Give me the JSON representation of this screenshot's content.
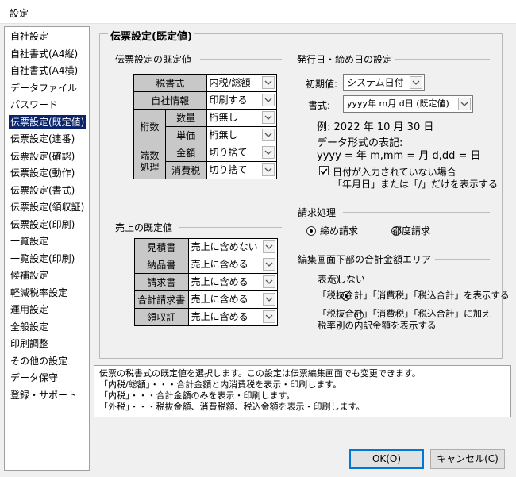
{
  "window": {
    "title": "設定"
  },
  "sidebar": {
    "items": [
      {
        "label": "自社設定"
      },
      {
        "label": "自社書式(A4縦)"
      },
      {
        "label": "自社書式(A4横)"
      },
      {
        "label": "データファイル"
      },
      {
        "label": "パスワード"
      },
      {
        "label": "伝票設定(既定値)",
        "selected": true
      },
      {
        "label": "伝票設定(連番)"
      },
      {
        "label": "伝票設定(確認)"
      },
      {
        "label": "伝票設定(動作)"
      },
      {
        "label": "伝票設定(書式)"
      },
      {
        "label": "伝票設定(領収証)"
      },
      {
        "label": "伝票設定(印刷)"
      },
      {
        "label": "一覧設定"
      },
      {
        "label": "一覧設定(印刷)"
      },
      {
        "label": "候補設定"
      },
      {
        "label": "軽減税率設定"
      },
      {
        "label": "運用設定"
      },
      {
        "label": "全般設定"
      },
      {
        "label": "印刷調整"
      },
      {
        "label": "その他の設定"
      },
      {
        "label": "データ保守"
      },
      {
        "label": "登録・サポート"
      }
    ]
  },
  "main": {
    "group_title": "伝票設定(既定値)",
    "voucher_defaults": {
      "heading": "伝票設定の既定値",
      "tax_format_label": "税書式",
      "tax_format_value": "内税/総額",
      "company_info_label": "自社情報",
      "company_info_value": "印刷する",
      "digits_label": "桁数",
      "quantity_label": "数量",
      "quantity_value": "桁無し",
      "unit_price_label": "単価",
      "unit_price_value": "桁無し",
      "rounding_label_1": "端数",
      "rounding_label_2": "処理",
      "amount_label": "金額",
      "amount_value": "切り捨て",
      "consumption_tax_label": "消費税",
      "consumption_tax_value": "切り捨て"
    },
    "issue_date": {
      "heading": "発行日・締め日の設定",
      "initial_label": "初期値:",
      "initial_value": "システム日付",
      "format_label": "書式:",
      "format_value": "yyyy年 m月 d日 (既定値)",
      "example": "例: 2022 年 10 月 30 日",
      "notation_title": "データ形式の表記:",
      "notation_text": "yyyy = 年 m,mm = 月 d,dd = 日",
      "blank_date_checkbox_line1": "日付が入力されていない場合",
      "blank_date_checkbox_line2": "「年月日」または「/」だけを表示する",
      "blank_date_checked": true
    },
    "billing": {
      "heading": "請求処理",
      "option_closing": "締め請求",
      "option_each": "都度請求",
      "selected": "締め請求"
    },
    "totals_area": {
      "heading": "編集画面下部の合計金額エリア",
      "option_hide": "表示しない",
      "option_show": "「税抜合計」「消費税」「税込合計」を表示する",
      "option_breakdown_line1": "「税抜合計」「消費税」「税込合計」に加え",
      "option_breakdown_line2": "税率別の内訳金額を表示する",
      "selected": "option_show"
    },
    "sales_defaults": {
      "heading": "売上の既定値",
      "rows": [
        {
          "label": "見積書",
          "value": "売上に含めない"
        },
        {
          "label": "納品書",
          "value": "売上に含める"
        },
        {
          "label": "請求書",
          "value": "売上に含める"
        },
        {
          "label": "合計請求書",
          "value": "売上に含める"
        },
        {
          "label": "領収証",
          "value": "売上に含める"
        }
      ]
    },
    "info_lines": [
      "伝票の税書式の既定値を選択します。この設定は伝票編集画面でも変更できます。",
      "「内税/総額」・・・合計金額と内消費税を表示・印刷します。",
      "「内税」・・・合計金額のみを表示・印刷します。",
      "「外税」・・・税抜金額、消費税額、税込金額を表示・印刷します。"
    ]
  },
  "buttons": {
    "ok": "OK(O)",
    "cancel": "キャンセル(C)"
  }
}
